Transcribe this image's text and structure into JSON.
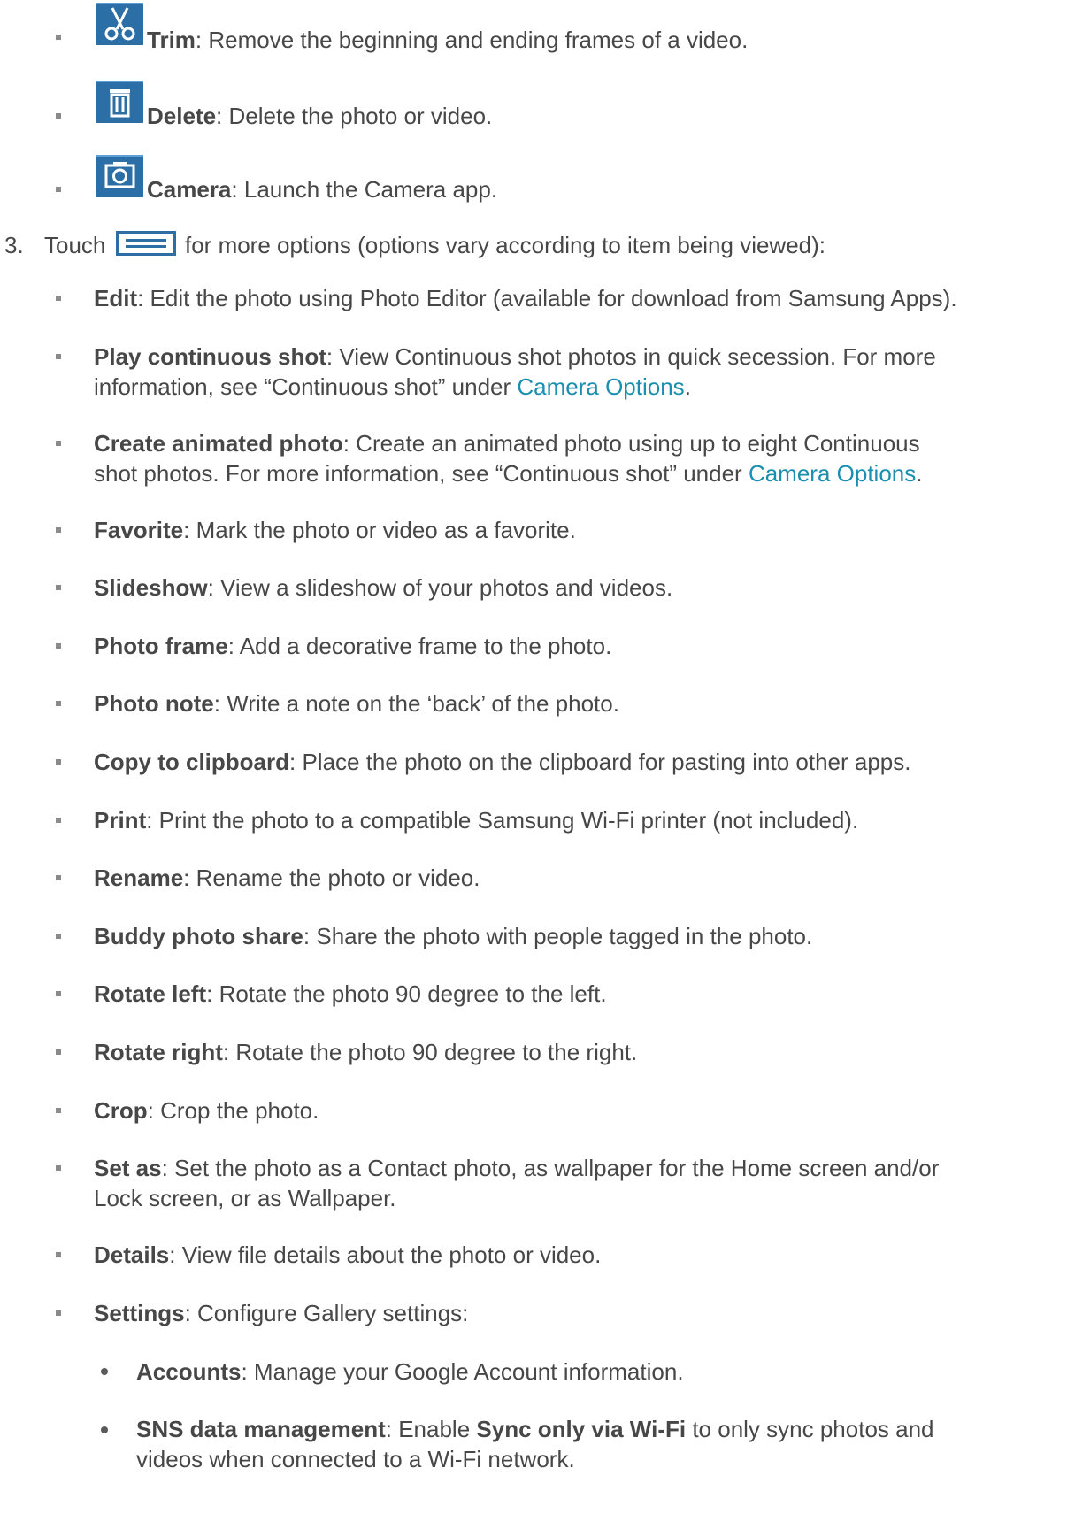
{
  "icon_items": [
    {
      "term": "Trim",
      "desc": ": Remove the beginning and ending frames of a video.",
      "icon": "scissors-icon"
    },
    {
      "term": "Delete",
      "desc": ": Delete the photo or video.",
      "icon": "trash-icon"
    },
    {
      "term": "Camera",
      "desc": ": Launch the Camera app.",
      "icon": "camera-icon"
    }
  ],
  "step3": {
    "number": "3.",
    "before": "Touch",
    "after": "for more options (options vary according to item being viewed):",
    "icon": "menu-icon"
  },
  "options": [
    {
      "term": "Edit",
      "lines": [
        ": Edit the photo using Photo Editor (available for download from Samsung Apps)."
      ]
    },
    {
      "term": "Play continuous shot",
      "lines": [
        ": View Continuous shot photos in quick secession. For more",
        "information, see “Continuous shot” under "
      ],
      "link": "Camera Options",
      "link_tail": "."
    },
    {
      "term": "Create animated photo",
      "lines": [
        ": Create an animated photo using up to eight Continuous",
        "shot photos. For more information, see “Continuous shot” under "
      ],
      "link": "Camera Options",
      "link_tail": "."
    },
    {
      "term": "Favorite",
      "lines": [
        ": Mark the photo or video as a favorite."
      ]
    },
    {
      "term": "Slideshow",
      "lines": [
        ": View a slideshow of your photos and videos."
      ]
    },
    {
      "term": "Photo frame",
      "lines": [
        ": Add a decorative frame to the photo."
      ]
    },
    {
      "term": "Photo note",
      "lines": [
        ": Write a note on the ‘back’ of the photo."
      ]
    },
    {
      "term": "Copy to clipboard",
      "lines": [
        ": Place the photo on the clipboard for pasting into other apps."
      ]
    },
    {
      "term": "Print",
      "lines": [
        ": Print the photo to a compatible Samsung Wi-Fi printer (not included)."
      ]
    },
    {
      "term": "Rename",
      "lines": [
        ": Rename the photo or video."
      ]
    },
    {
      "term": "Buddy photo share",
      "lines": [
        ": Share the photo with people tagged in the photo."
      ]
    },
    {
      "term": "Rotate left",
      "lines": [
        ": Rotate the photo 90 degree to the left."
      ]
    },
    {
      "term": "Rotate right",
      "lines": [
        ": Rotate the photo 90 degree to the right."
      ]
    },
    {
      "term": "Crop",
      "lines": [
        ": Crop the photo."
      ]
    },
    {
      "term": "Set as",
      "lines": [
        ": Set the photo as a Contact photo, as wallpaper for the Home screen and/or",
        "Lock screen, or as Wallpaper."
      ]
    },
    {
      "term": "Details",
      "lines": [
        ": View file details about the photo or video."
      ]
    },
    {
      "term": "Settings",
      "lines": [
        ": Configure Gallery settings:"
      ]
    }
  ],
  "settings_items": [
    {
      "term": "Accounts",
      "desc": ": Manage your Google Account information."
    },
    {
      "term": "SNS data management",
      "desc_a": ": Enable ",
      "term2": "Sync only via Wi-Fi",
      "desc_b": " to only sync photos and",
      "line2": "videos when connected to a Wi-Fi network."
    }
  ],
  "colors": {
    "text": "#474747",
    "link": "#1a8fb0",
    "icon_blue": "#2c6fa6"
  }
}
